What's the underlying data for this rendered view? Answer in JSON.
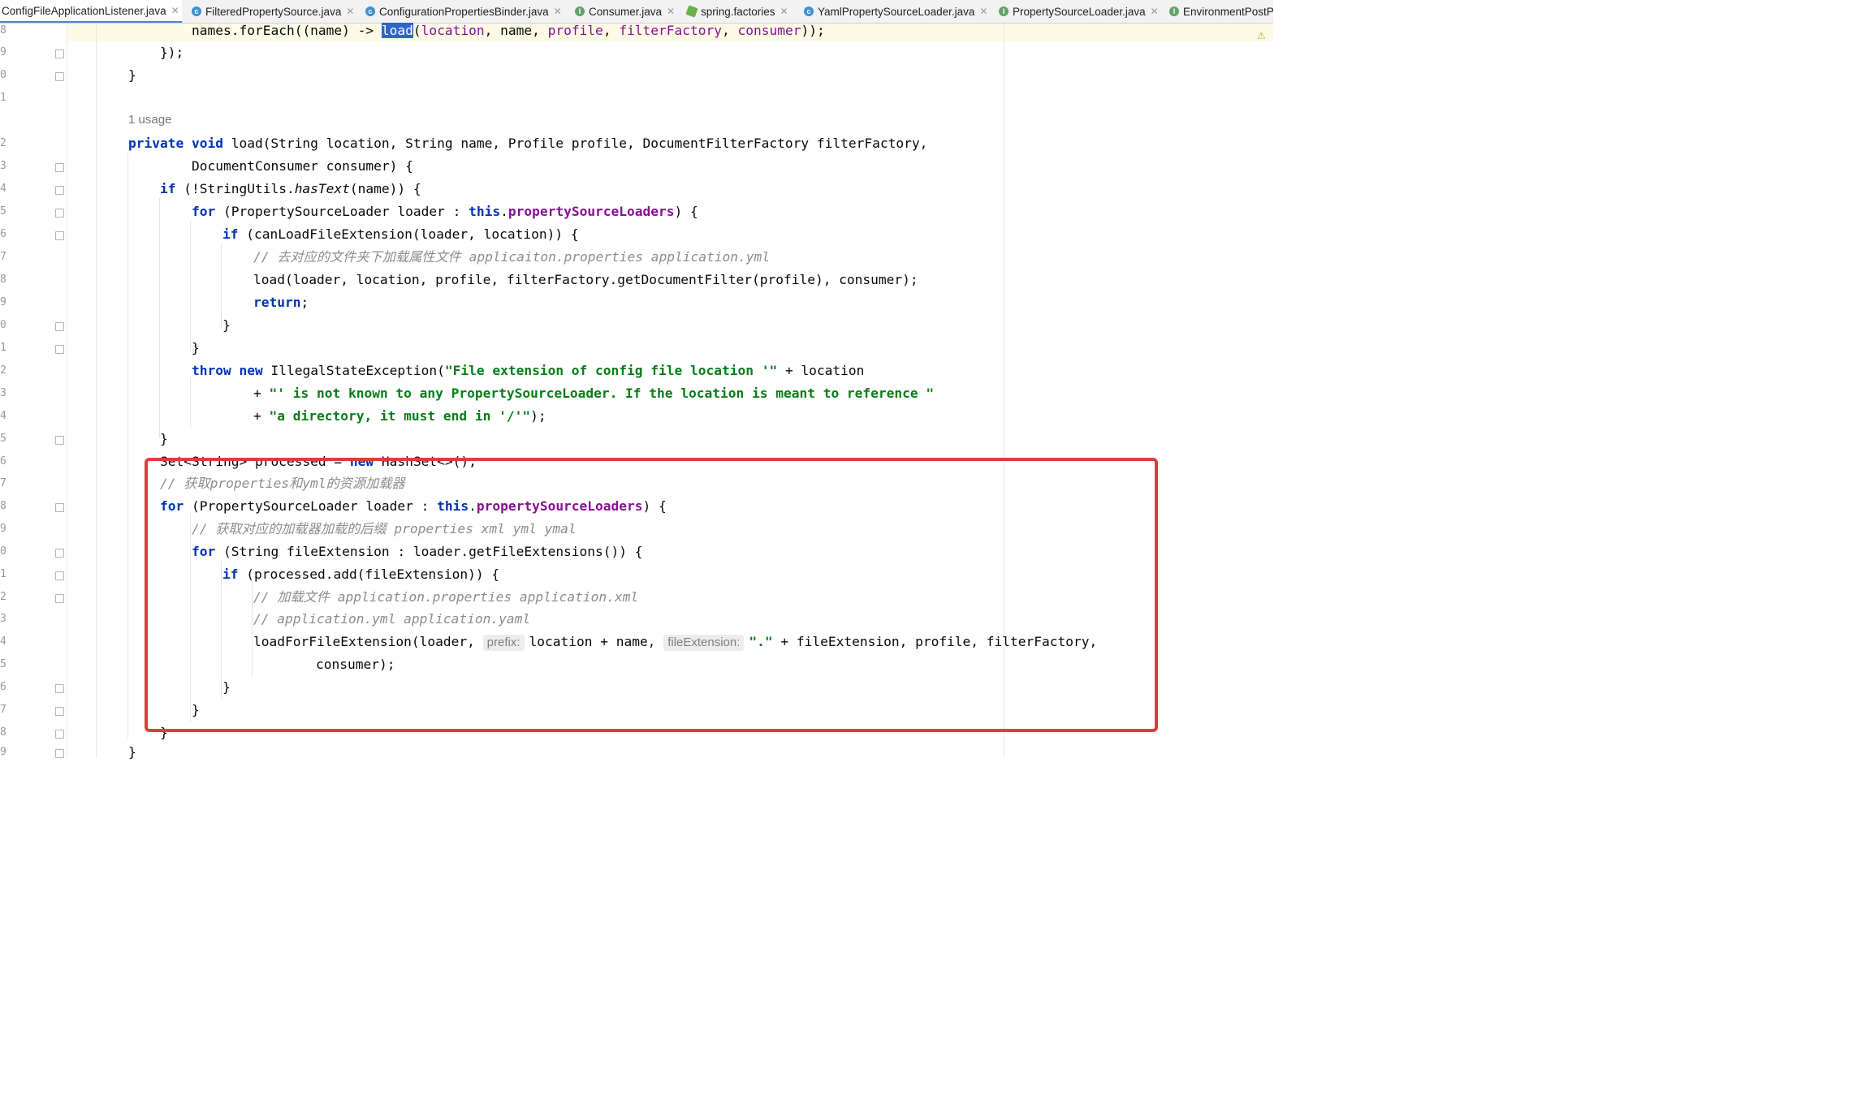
{
  "tabs": [
    {
      "label": "ConfigFileApplicationListener.java",
      "icon": "class-icon",
      "active": true
    },
    {
      "label": "FilteredPropertySource.java",
      "icon": "class-icon"
    },
    {
      "label": "ConfigurationPropertiesBinder.java",
      "icon": "class-icon"
    },
    {
      "label": "Consumer.java",
      "icon": "interface-icon"
    },
    {
      "label": "spring.factories",
      "icon": "spring-icon"
    },
    {
      "label": "YamlPropertySourceLoader.java",
      "icon": "class-icon"
    },
    {
      "label": "PropertySourceLoader.java",
      "icon": "interface-icon"
    },
    {
      "label": "EnvironmentPostPr",
      "icon": "interface-icon"
    }
  ],
  "gutter": [
    "8",
    "9",
    "0",
    "1",
    "",
    "2",
    "3",
    "4",
    "5",
    "6",
    "7",
    "8",
    "9",
    "0",
    "1",
    "2",
    "3",
    "4",
    "5",
    "6",
    "7",
    "8",
    "9",
    "0",
    "1",
    "2",
    "3",
    "4",
    "5",
    "6",
    "7",
    "8",
    "9"
  ],
  "usage_hint": "1 usage",
  "param_hints": {
    "prefix": "prefix:",
    "file_extension": "fileExtension:"
  },
  "code": {
    "l1_pre": "names.forEach((name) -> ",
    "l1_sel": "load",
    "l1_a": "(",
    "l1_b": "location",
    "l1_c": ", name, ",
    "l1_d": "profile",
    "l1_e": ", ",
    "l1_f": "filterFactory",
    "l1_g": ", ",
    "l1_h": "consumer",
    "l1_i": "));",
    "l2": "});",
    "l3": "}",
    "l5_kw": "private void ",
    "l5_rest": "load(String location, String name, Profile profile, DocumentFilterFactory filterFactory,",
    "l6": "DocumentConsumer consumer) {",
    "l7_kw": "if",
    "l7_a": " (!StringUtils.",
    "l7_it": "hasText",
    "l7_b": "(name)) {",
    "l8_kw": "for",
    "l8_a": " (PropertySourceLoader loader : ",
    "l8_this": "this",
    "l8_dot": ".",
    "l8_fld": "propertySourceLoaders",
    "l8_b": ") {",
    "l9_kw": "if",
    "l9_a": " (canLoadFileExtension(loader, location)) {",
    "l10": "// 去对应的文件夹下加载属性文件 applicaiton.properties application.yml",
    "l11": "load(loader, location, profile, filterFactory.getDocumentFilter(profile), consumer);",
    "l12_kw": "return",
    "l12_a": ";",
    "l13": "}",
    "l14": "}",
    "l15_kw": "throw new ",
    "l15_a": "IllegalStateException(",
    "l15_str": "\"File extension of config file location '\"",
    "l15_b": " + location",
    "l16_a": "+ ",
    "l16_str": "\"' is not known to any PropertySourceLoader. If the location is meant to reference \"",
    "l17_a": "+ ",
    "l17_str": "\"a directory, it must end in '/'\"",
    "l17_b": ");",
    "l18": "}",
    "l19_a": "Set<String> processed = ",
    "l19_kw": "new",
    "l19_b": " HashSet<>();",
    "l20": "// 获取properties和yml的资源加载器",
    "l21_kw": "for",
    "l21_a": " (PropertySourceLoader loader : ",
    "l21_this": "this",
    "l21_dot": ".",
    "l21_fld": "propertySourceLoaders",
    "l21_b": ") {",
    "l22": "// 获取对应的加载器加载的后缀 properties xml yml ymal",
    "l23_kw": "for",
    "l23_a": " (String fileExtension : loader.getFileExtensions()) {",
    "l24_kw": "if",
    "l24_a": " (processed.add(fileExtension)) {",
    "l25": "// 加载文件 application.properties application.xml",
    "l26": "// application.yml application.yaml",
    "l27_a": "loadForFileExtension(loader, ",
    "l27_b": "location + name, ",
    "l27_str": "\".\"",
    "l27_c": " + fileExtension, profile, filterFactory,",
    "l28": "consumer);",
    "l29": "}",
    "l30": "}",
    "l31": "}",
    "l32": "}"
  },
  "colors": {
    "keyword": "#0033b3",
    "field": "#871094",
    "string": "#067d17",
    "comment": "#8c8c8c",
    "highlight_box": "#e23b3b",
    "selection": "#2f65ca"
  }
}
